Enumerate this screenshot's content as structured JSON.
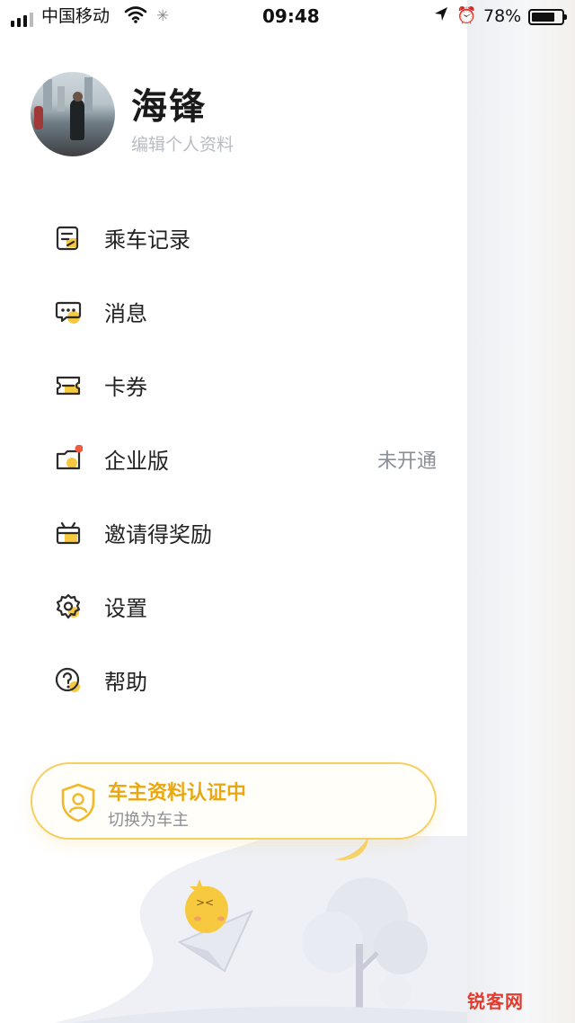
{
  "status_bar": {
    "carrier": "中国移动",
    "time": "09:48",
    "battery_percent": "78%",
    "battery_level": 0.78
  },
  "profile": {
    "name": "海锋",
    "edit_label": "编辑个人资料"
  },
  "menu": {
    "items": [
      {
        "label": "乘车记录",
        "icon": "ride-history-icon"
      },
      {
        "label": "消息",
        "icon": "message-icon"
      },
      {
        "label": "卡券",
        "icon": "coupon-icon"
      },
      {
        "label": "企业版",
        "icon": "enterprise-icon",
        "value": "未开通",
        "badge_color": "#f05a3e"
      },
      {
        "label": "邀请得奖励",
        "icon": "gift-icon"
      },
      {
        "label": "设置",
        "icon": "settings-icon"
      },
      {
        "label": "帮助",
        "icon": "help-icon"
      }
    ]
  },
  "driver_card": {
    "title": "车主资料认证中",
    "subtitle": "切换为车主",
    "icon": "shield-user-icon"
  },
  "watermark": {
    "text": "锐客网"
  },
  "colors": {
    "accent_yellow": "#f7c93e",
    "driver_title": "#e9a811",
    "badge_red": "#f05a3e",
    "icon_stroke": "#2b2b2b"
  }
}
